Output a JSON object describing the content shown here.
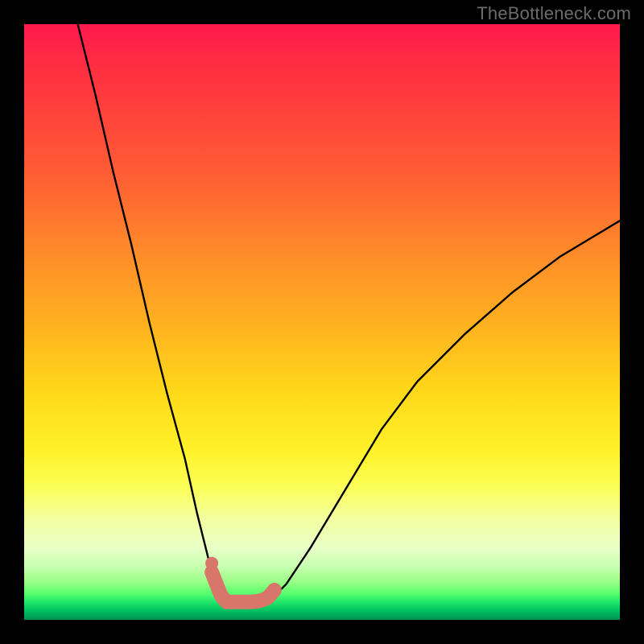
{
  "watermark": "TheBottleneck.com",
  "chart_data": {
    "type": "line",
    "title": "",
    "xlabel": "",
    "ylabel": "",
    "xlim": [
      0,
      100
    ],
    "ylim": [
      0,
      100
    ],
    "grid": false,
    "legend": false,
    "description": "Bottleneck curve: black V-shaped line over a vertical crimson→orange→yellow→green gradient; salmon/pink highlight segment spans the trough near the bottom.",
    "series": [
      {
        "name": "bottleneck-curve",
        "color": "#000000",
        "x": [
          9,
          12,
          15,
          18,
          21,
          24,
          27,
          29,
          31,
          33,
          33.5,
          34,
          35,
          36,
          38,
          40,
          42,
          44,
          48,
          54,
          60,
          66,
          74,
          82,
          90,
          100
        ],
        "values": [
          100,
          88,
          75,
          63,
          50,
          38,
          27,
          18,
          10,
          5,
          3.5,
          3,
          3,
          3,
          3,
          3.2,
          4,
          6,
          12,
          22,
          32,
          40,
          48,
          55,
          61,
          67
        ]
      },
      {
        "name": "trough-highlight",
        "color": "#d9766b",
        "x": [
          31.5,
          33,
          33.5,
          34,
          35,
          36,
          37,
          38,
          39,
          40,
          41,
          42
        ],
        "values": [
          8,
          4.2,
          3.5,
          3,
          3,
          3,
          3,
          3,
          3.1,
          3.3,
          3.8,
          5
        ]
      }
    ],
    "gradient_stops": [
      {
        "pos": 0,
        "color": "#ff1a4d"
      },
      {
        "pos": 25,
        "color": "#ff5c34"
      },
      {
        "pos": 50,
        "color": "#ffb020"
      },
      {
        "pos": 72,
        "color": "#fff22a"
      },
      {
        "pos": 88,
        "color": "#e8ffc8"
      },
      {
        "pos": 95,
        "color": "#5cff70"
      },
      {
        "pos": 100,
        "color": "#009050"
      }
    ]
  }
}
